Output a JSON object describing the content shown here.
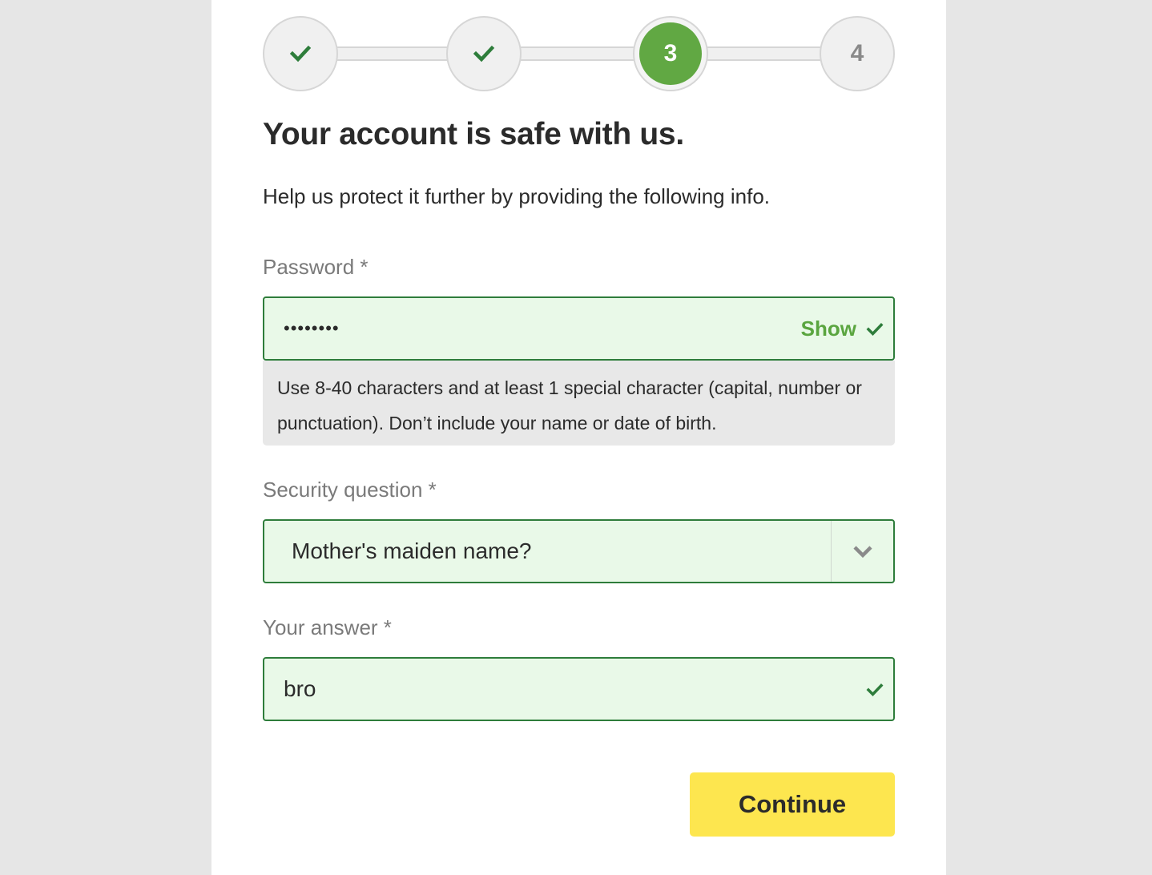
{
  "stepper": {
    "steps": [
      {
        "label": "",
        "state": "complete",
        "icon": "check-icon"
      },
      {
        "label": "",
        "state": "complete",
        "icon": "check-icon"
      },
      {
        "label": "3",
        "state": "current"
      },
      {
        "label": "4",
        "state": "upcoming"
      }
    ]
  },
  "headline": "Your account is safe with us.",
  "subtitle": "Help us protect it further by providing the following info.",
  "password": {
    "label": "Password *",
    "masked_value": "••••••••",
    "show_label": "Show",
    "hint": "Use 8-40 characters and at least 1 special character (capital, number or punctuation). Don’t include your name or date of birth."
  },
  "security_question": {
    "label": "Security question *",
    "selected": "Mother's maiden name?"
  },
  "answer": {
    "label": "Your answer *",
    "value": "bro"
  },
  "continue_label": "Continue",
  "colors": {
    "accent_green": "#61a843",
    "valid_border": "#2e7d3b",
    "valid_bg": "#e9f9e8",
    "button_yellow": "#fde64f"
  }
}
